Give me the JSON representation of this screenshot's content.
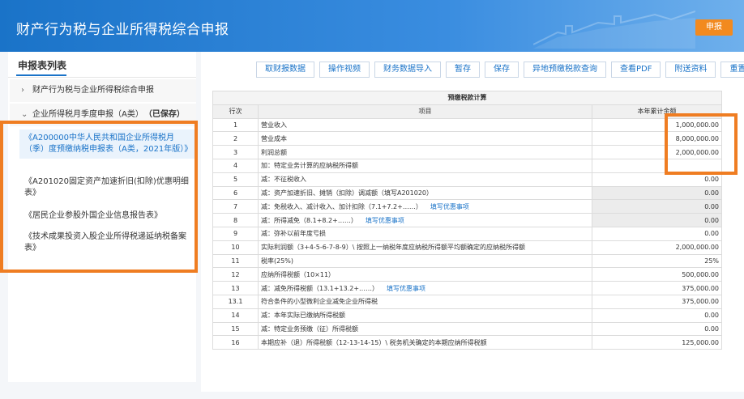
{
  "app": {
    "title": "财产行为税与企业所得税综合申报",
    "submit_label": "申报"
  },
  "sidebar": {
    "title": "申报表列表",
    "groups": [
      {
        "chevron": "›",
        "label": "财产行为税与企业所得税综合申报",
        "status": ""
      },
      {
        "chevron": "⌄",
        "label": "企业所得税月季度申报（A类）",
        "status": "（已保存）"
      }
    ],
    "items": [
      {
        "label": "《A200000中华人民共和国企业所得税月（季）度预缴纳税申报表（A类，2021年版）》"
      },
      {
        "label": "《A201020固定资产加速折旧(扣除)优惠明细表》"
      },
      {
        "label": "《居民企业参股外国企业信息报告表》"
      },
      {
        "label": "《技术成果投资入股企业所得税递延纳税备案表》"
      }
    ]
  },
  "toolbar": {
    "buttons": [
      "取财报数据",
      "操作视频",
      "财务数据导入",
      "暂存",
      "保存",
      "异地预缴税款查询",
      "查看PDF",
      "附送资料",
      "重置"
    ]
  },
  "table": {
    "caption": "预缴税款计算",
    "headers": {
      "no": "行次",
      "item": "项目",
      "amount": "本年累计金额"
    },
    "rows": [
      {
        "no": "1",
        "item": "营业收入",
        "link": "",
        "amount": "1,000,000.00",
        "grey": false
      },
      {
        "no": "2",
        "item": "营业成本",
        "link": "",
        "amount": "8,000,000.00",
        "grey": false
      },
      {
        "no": "3",
        "item": "利润总额",
        "link": "",
        "amount": "2,000,000.00",
        "grey": false
      },
      {
        "no": "4",
        "item": "加：特定业务计算的应纳税所得额",
        "link": "",
        "amount": "",
        "grey": false
      },
      {
        "no": "5",
        "item": "减：不征税收入",
        "link": "",
        "amount": "0.00",
        "grey": false
      },
      {
        "no": "6",
        "item": "减：资产加速折旧、摊销（扣除）调减额（填写A201020）",
        "link": "",
        "amount": "0.00",
        "grey": true
      },
      {
        "no": "7",
        "item": "减：免税收入、减计收入、加计扣除（7.1+7.2+……）",
        "link": "填写优惠事项",
        "amount": "0.00",
        "grey": true
      },
      {
        "no": "8",
        "item": "减：所得减免（8.1+8.2+……）",
        "link": "填写优惠事项",
        "amount": "0.00",
        "grey": true
      },
      {
        "no": "9",
        "item": "减：弥补以前年度亏损",
        "link": "",
        "amount": "0.00",
        "grey": false
      },
      {
        "no": "10",
        "item": "实际利润额（3+4-5-6-7-8-9）\\ 按照上一纳税年度应纳税所得额平均额确定的应纳税所得额",
        "link": "",
        "amount": "2,000,000.00",
        "grey": false
      },
      {
        "no": "11",
        "item": "税率(25%)",
        "link": "",
        "amount": "25%",
        "grey": false
      },
      {
        "no": "12",
        "item": "应纳所得税额（10×11）",
        "link": "",
        "amount": "500,000.00",
        "grey": false
      },
      {
        "no": "13",
        "item": "减：减免所得税额（13.1+13.2+……）",
        "link": "填写优惠事项",
        "amount": "375,000.00",
        "grey": false
      },
      {
        "no": "13.1",
        "item": "符合条件的小型微利企业减免企业所得税",
        "link": "",
        "amount": "375,000.00",
        "grey": false
      },
      {
        "no": "14",
        "item": "减：本年实际已缴纳所得税额",
        "link": "",
        "amount": "0.00",
        "grey": false
      },
      {
        "no": "15",
        "item": "减：特定业务预缴（征）所得税额",
        "link": "",
        "amount": "0.00",
        "grey": false
      },
      {
        "no": "16",
        "item": "本期应补（退）所得税额（12-13-14-15）\\ 税务机关确定的本期应纳所得税额",
        "link": "",
        "amount": "125,000.00",
        "grey": false
      }
    ]
  },
  "colors": {
    "header_blue": "#1a73c8",
    "highlight_orange": "#ef7d22",
    "submit_orange": "#f28a1f",
    "link_blue": "#1a73c8"
  }
}
